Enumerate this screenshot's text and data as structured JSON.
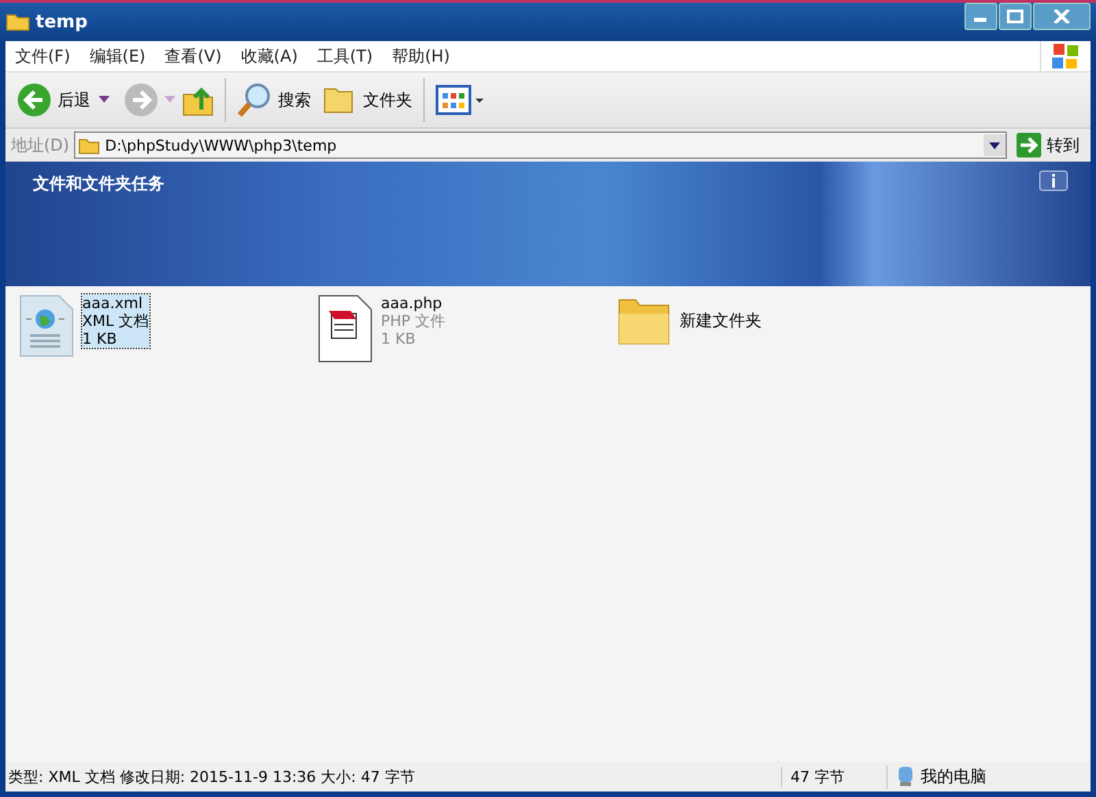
{
  "window": {
    "title": "temp"
  },
  "menu": [
    "文件(F)",
    "编辑(E)",
    "查看(V)",
    "收藏(A)",
    "工具(T)",
    "帮助(H)"
  ],
  "toolbar": {
    "back": "后退",
    "search": "搜索",
    "folders": "文件夹"
  },
  "address": {
    "label": "地址(D)",
    "value": "D:\\phpStudy\\WWW\\php3\\temp",
    "go": "转到"
  },
  "banner": {
    "title": "文件和文件夹任务"
  },
  "files": [
    {
      "kind": "xml",
      "name": "aaa.xml",
      "type": "XML 文档",
      "size": "1 KB",
      "selected": true
    },
    {
      "kind": "php",
      "name": "aaa.php",
      "type": "PHP 文件",
      "size": "1 KB",
      "selected": false
    },
    {
      "kind": "folder",
      "name": "新建文件夹",
      "selected": false
    }
  ],
  "status_bar": {
    "details": "类型: XML 文档 修改日期: 2015-11-9 13:36 大小: 47 字节",
    "size": "47 字节",
    "zone": "我的电脑"
  }
}
